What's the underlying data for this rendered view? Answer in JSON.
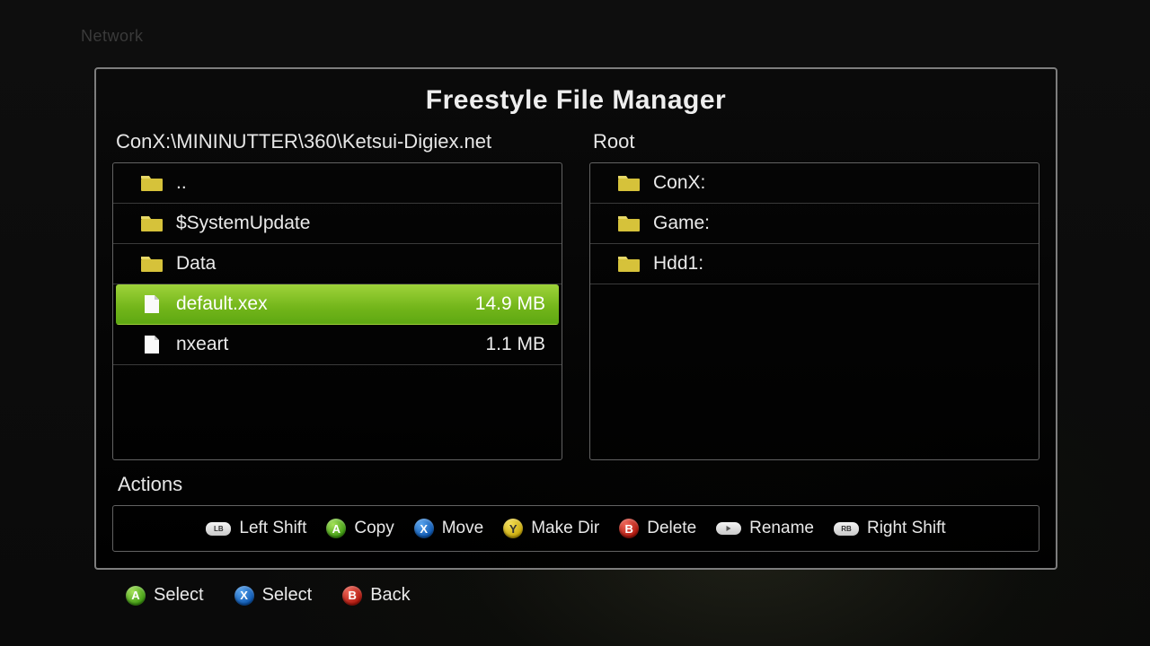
{
  "background": {
    "network_label": "Network"
  },
  "dialog": {
    "title": "Freestyle File Manager",
    "left": {
      "path": "ConX:\\MININUTTER\\360\\Ketsui-Digiex.net",
      "items": [
        {
          "icon": "folder",
          "name": "..",
          "size": "",
          "selected": false
        },
        {
          "icon": "folder",
          "name": "$SystemUpdate",
          "size": "",
          "selected": false
        },
        {
          "icon": "folder",
          "name": "Data",
          "size": "",
          "selected": false
        },
        {
          "icon": "file",
          "name": "default.xex",
          "size": "14.9 MB",
          "selected": true
        },
        {
          "icon": "file",
          "name": "nxeart",
          "size": "1.1 MB",
          "selected": false
        }
      ]
    },
    "right": {
      "path": "Root",
      "items": [
        {
          "icon": "folder",
          "name": "ConX:",
          "size": "",
          "selected": false
        },
        {
          "icon": "folder",
          "name": "Game:",
          "size": "",
          "selected": false
        },
        {
          "icon": "folder",
          "name": "Hdd1:",
          "size": "",
          "selected": false
        }
      ]
    },
    "actions_label": "Actions",
    "actions": [
      {
        "button": "LB",
        "label": "Left Shift"
      },
      {
        "button": "A",
        "label": "Copy"
      },
      {
        "button": "X",
        "label": "Move"
      },
      {
        "button": "Y",
        "label": "Make Dir"
      },
      {
        "button": "B",
        "label": "Delete"
      },
      {
        "button": "START",
        "label": "Rename"
      },
      {
        "button": "RB",
        "label": "Right Shift"
      }
    ]
  },
  "footer": [
    {
      "button": "A",
      "label": "Select"
    },
    {
      "button": "X",
      "label": "Select"
    },
    {
      "button": "B",
      "label": "Back"
    }
  ]
}
